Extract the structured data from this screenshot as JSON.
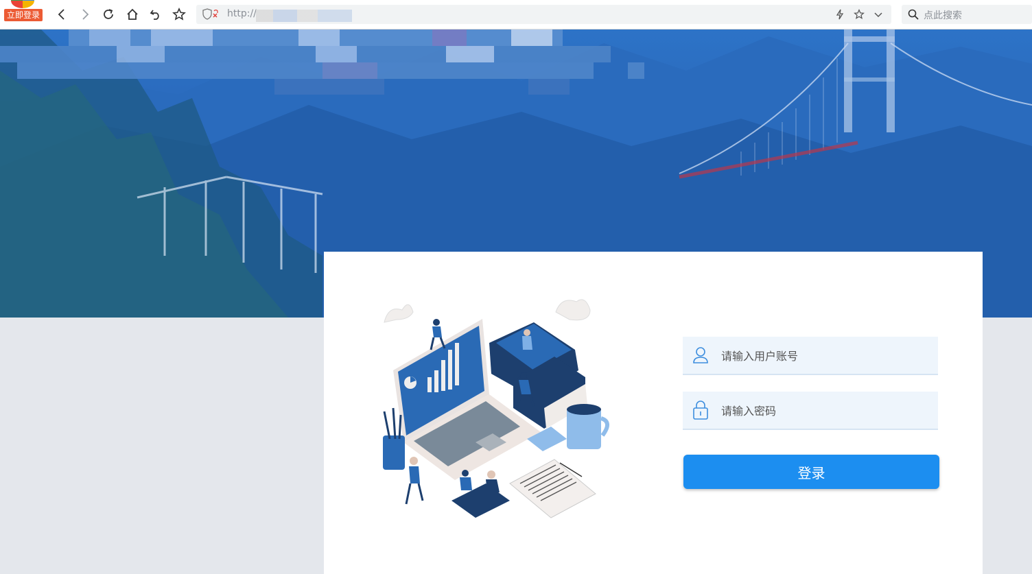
{
  "browser": {
    "login_badge": "立即登录",
    "url_text": "http://",
    "search_placeholder": "点此搜索",
    "icons": [
      "back-icon",
      "forward-icon",
      "reload-icon",
      "home-icon",
      "undo-icon",
      "bookmark-star-icon",
      "security-shield-icon",
      "lightning-icon",
      "favorite-star-icon",
      "dropdown-chevron-icon",
      "search-icon"
    ]
  },
  "login": {
    "username_placeholder": "请输入用户账号",
    "password_placeholder": "请输入密码",
    "submit_label": "登录"
  },
  "colors": {
    "banner_blue": "#2966b8",
    "button_blue": "#1c8ef0",
    "field_bg": "#eef5fc",
    "page_bg": "#e4e7ec",
    "badge_orange": "#ec5b34"
  }
}
